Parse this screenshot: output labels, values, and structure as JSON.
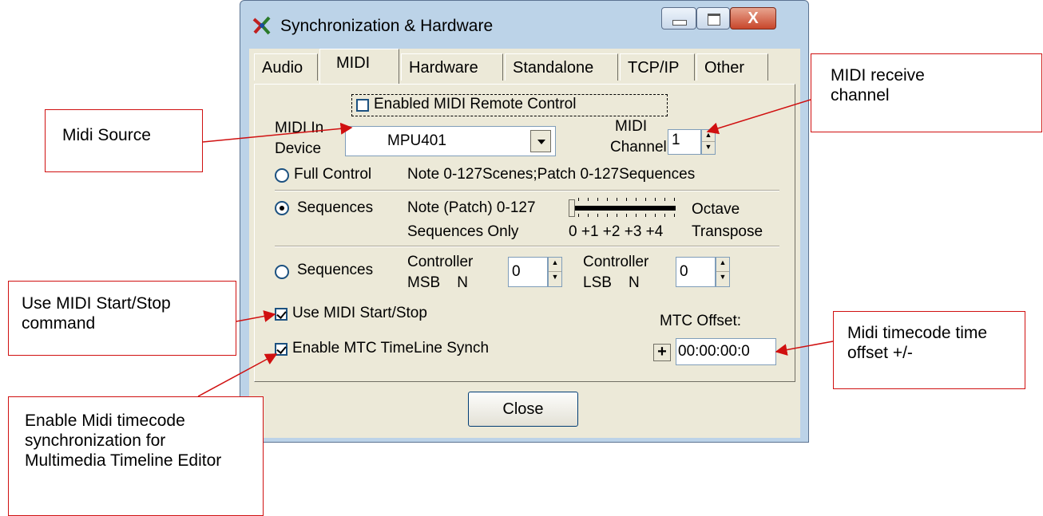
{
  "window": {
    "title": "Synchronization & Hardware",
    "close_glyph": "X",
    "tabs": [
      {
        "label": "Audio",
        "active": false
      },
      {
        "label": "MIDI",
        "active": true
      },
      {
        "label": "Hardware",
        "active": false
      },
      {
        "label": "Standalone",
        "active": false
      },
      {
        "label": "TCP/IP",
        "active": false
      },
      {
        "label": "Other",
        "active": false
      }
    ]
  },
  "midi": {
    "remote_control_label": "Enabled MIDI Remote Control",
    "remote_control_checked": false,
    "in_device_label_1": "MIDI In",
    "in_device_label_2": "Device",
    "in_device_value": "MPU401",
    "channel_label_1": "MIDI",
    "channel_label_2": "Channel",
    "channel_value": "1",
    "full_control_label": "Full Control",
    "full_control_desc": "Note 0-127Scenes;Patch 0-127Sequences",
    "sequences_label": "Sequences",
    "sequences_desc_1": "Note (Patch) 0-127",
    "sequences_desc_2": "Sequences Only",
    "octave_label": "Octave",
    "transpose_label": "Transpose",
    "octave_ticks": "0 +1 +2 +3 +4",
    "controller_mode_label": "Sequences",
    "controller1_label_1": "Controller",
    "controller1_label_2": "MSB    N",
    "controller1_value": "0",
    "controller2_label_1": "Controller",
    "controller2_label_2": "LSB    N",
    "controller2_value": "0",
    "start_stop_label": "Use MIDI Start/Stop",
    "mtc_label": "Enable MTC TimeLine Synch",
    "mtc_offset_label": "MTC Offset:",
    "mtc_sign": "+",
    "mtc_offset_value": "00:00:00:0",
    "close_label": "Close"
  },
  "callouts": {
    "midi_source": "Midi Source",
    "receive_channel": "MIDI receive channel",
    "start_stop": "Use MIDI Start/Stop command",
    "timecode_offset": "Midi timecode time offset +/-",
    "timecode_sync": "Enable Midi timecode synchronization for Multimedia Timeline Editor"
  },
  "colors": {
    "callout_border": "#d01010",
    "window_frame": "#bcd3e8",
    "dialog_face": "#ece9d8"
  },
  "icons": [
    "app-icon",
    "minimize-icon",
    "maximize-icon",
    "close-icon",
    "dropdown-arrow-icon",
    "spin-up-icon",
    "spin-down-icon"
  ]
}
